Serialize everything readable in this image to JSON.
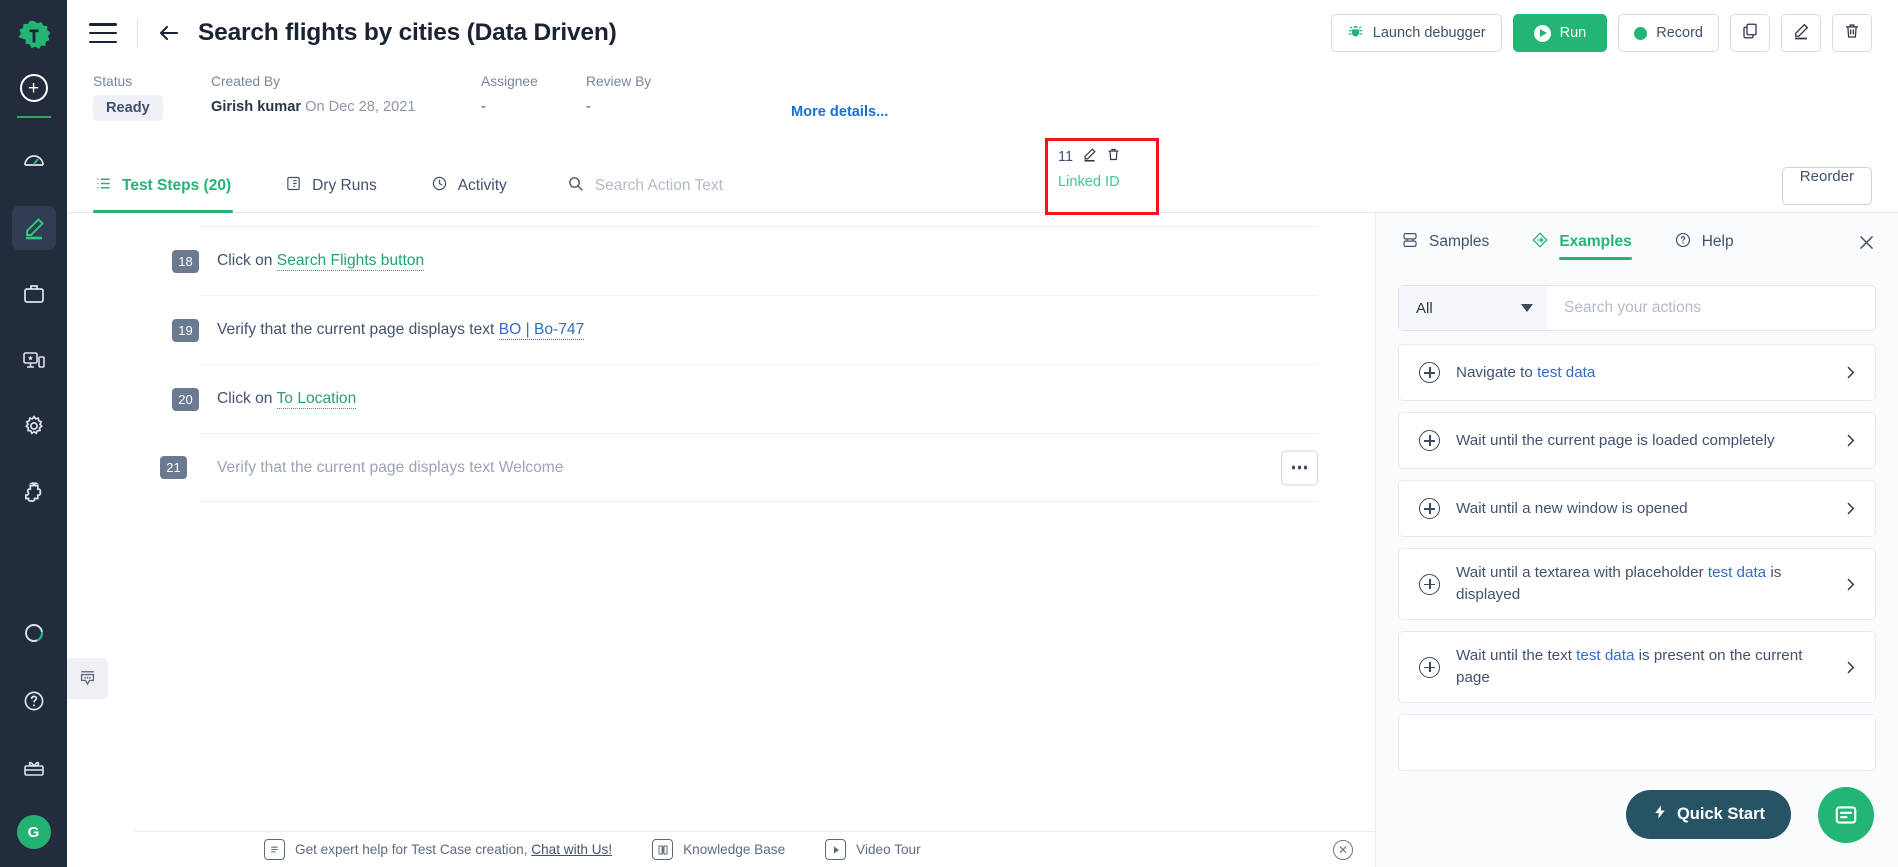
{
  "rail": {
    "logo_icon": "testsigma-logo-icon",
    "add_button": "+",
    "items": [
      {
        "name": "dashboard",
        "icon": "speedometer-icon"
      },
      {
        "name": "test-authoring",
        "icon": "pencil-icon",
        "active": true
      },
      {
        "name": "test-plans",
        "icon": "briefcase-icon"
      },
      {
        "name": "test-labs",
        "icon": "devices-icon"
      },
      {
        "name": "settings",
        "icon": "gear-icon"
      },
      {
        "name": "addons",
        "icon": "puzzle-icon"
      }
    ],
    "bottom_items": [
      {
        "name": "progress",
        "icon": "spinner-icon"
      },
      {
        "name": "help",
        "icon": "question-circle-icon"
      },
      {
        "name": "whats-new",
        "icon": "gift-icon"
      }
    ],
    "avatar_initial": "G"
  },
  "header": {
    "menu_icon": "hamburger-icon",
    "back_icon": "arrow-left-icon",
    "title": "Search flights by cities (Data Driven)",
    "actions": {
      "launch_debugger": "Launch debugger",
      "run": "Run",
      "record": "Record",
      "copy_icon": "copy-icon",
      "edit_icon": "pencil-icon",
      "delete_icon": "trash-icon"
    }
  },
  "meta": {
    "status_label": "Status",
    "status_value": "Ready",
    "created_by_label": "Created By",
    "created_by_name": "Girish kumar",
    "created_on": "On Dec 28, 2021",
    "assignee_label": "Assignee",
    "assignee_value": "-",
    "review_by_label": "Review By",
    "review_by_value": "-",
    "more_details": "More details...",
    "linked": {
      "count": "11",
      "edit_icon": "pencil-icon",
      "delete_icon": "trash-icon",
      "label": "Linked ID",
      "highlight_color": "#f3141e"
    }
  },
  "tabs": {
    "items": [
      {
        "label": "Test Steps (20)",
        "icon": "list-icon",
        "active": true
      },
      {
        "label": "Dry Runs",
        "icon": "clipboard-icon",
        "active": false
      },
      {
        "label": "Activity",
        "icon": "clock-icon",
        "active": false
      }
    ],
    "search_placeholder": "Search Action Text",
    "search_icon": "search-icon",
    "reorder_label": "Reorder"
  },
  "steps": [
    {
      "num": "18",
      "prefix": "Click on ",
      "token": "Search Flights button",
      "token_color": "green",
      "suffix": "",
      "muted": false
    },
    {
      "num": "19",
      "prefix": "Verify that the current page displays text ",
      "token": "BO | Bo-747",
      "token_color": "blue",
      "suffix": "",
      "muted": false
    },
    {
      "num": "20",
      "prefix": "Click on ",
      "token": "To Location",
      "token_color": "green",
      "suffix": "",
      "muted": false
    },
    {
      "num": "21",
      "prefix": "Verify that the current page displays text Welcome",
      "token": "",
      "token_color": "",
      "suffix": "",
      "muted": true
    }
  ],
  "step_extras": {
    "comment_icon": "comment-icon",
    "kebab_icon": "more-options-icon"
  },
  "right_panel": {
    "tabs": [
      {
        "label": "Samples",
        "icon": "database-icon",
        "active": false
      },
      {
        "label": "Examples",
        "icon": "diamond-arrow-icon",
        "active": true
      },
      {
        "label": "Help",
        "icon": "question-circle-icon",
        "active": false
      }
    ],
    "close_icon": "close-icon",
    "filter_value": "All",
    "search_placeholder": "Search your actions",
    "examples": [
      {
        "parts": [
          {
            "t": "Navigate to ",
            "p": false
          },
          {
            "t": "test data",
            "p": true
          }
        ]
      },
      {
        "parts": [
          {
            "t": "Wait until the current page is loaded completely",
            "p": false
          }
        ]
      },
      {
        "parts": [
          {
            "t": "Wait until a new window is opened",
            "p": false
          }
        ]
      },
      {
        "parts": [
          {
            "t": "Wait until a textarea with placeholder ",
            "p": false
          },
          {
            "t": "test data",
            "p": true
          },
          {
            "t": " is displayed",
            "p": false
          }
        ]
      },
      {
        "parts": [
          {
            "t": "Wait until the text ",
            "p": false
          },
          {
            "t": "test data",
            "p": true
          },
          {
            "t": " is present on the current page",
            "p": false
          }
        ]
      },
      {
        "parts": [
          {
            "t": "",
            "p": false
          }
        ]
      }
    ]
  },
  "footer": {
    "help_text": "Get expert help for Test Case creation,",
    "chat_link": "Chat with Us!",
    "knowledge_base": "Knowledge Base",
    "video_tour": "Video Tour",
    "chat_icon": "chat-bubble-icon",
    "book_icon": "book-icon",
    "video_icon": "video-icon",
    "close_icon": "close-circle-icon"
  },
  "floating": {
    "quick_start": "Quick Start",
    "quick_start_icon": "lightning-icon",
    "chat_fab_icon": "chat-icon",
    "quick_start_bg": "#265465",
    "chat_fab_bg": "#22b573"
  }
}
